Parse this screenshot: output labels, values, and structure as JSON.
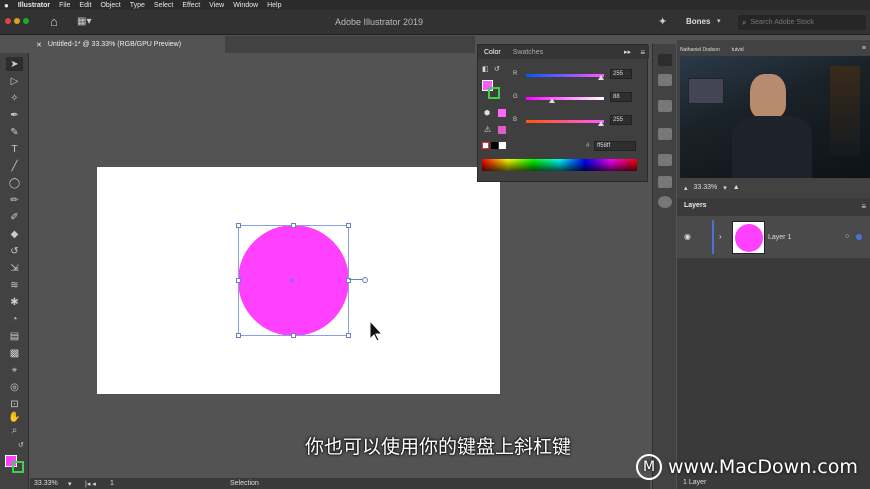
{
  "menubar": {
    "app_name": "Illustrator",
    "items": [
      "File",
      "Edit",
      "Object",
      "Type",
      "Select",
      "Effect",
      "View",
      "Window",
      "Help"
    ]
  },
  "topbar": {
    "title": "Adobe Illustrator 2019",
    "workspace": "Bones",
    "search_placeholder": "Search Adobe Stock"
  },
  "document": {
    "tab_label": "Untitled-1* @ 33.33% (RGB/GPU Preview)"
  },
  "color_panel": {
    "tabs": [
      "Color",
      "Swatches"
    ],
    "r_label": "R",
    "r_value": "255",
    "g_label": "G",
    "g_value": "88",
    "b_label": "B",
    "b_value": "255",
    "hex_prefix": "#",
    "hex_value": "ff58ff",
    "fill_color": "#ff58ff"
  },
  "webcam": {
    "tab1": "Nathaniel Dodson",
    "tab2": "tutvid"
  },
  "right_panel": {
    "zoom": "33.33%",
    "layers_title": "Layers",
    "layer_name": "Layer 1",
    "layer_count": "1 Layer"
  },
  "status": {
    "zoom": "33.33%",
    "artboard_num": "1",
    "tool": "Selection"
  },
  "subtitle": "你也可以使用你的键盘上斜杠键",
  "watermark": "www.MacDown.com",
  "colors": {
    "accent": "#ff40ff",
    "selection": "#6b7fc7"
  }
}
